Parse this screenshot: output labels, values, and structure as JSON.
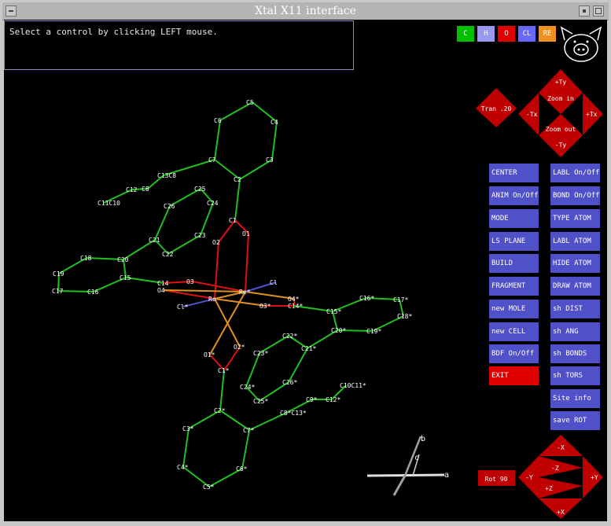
{
  "window": {
    "title": "Xtal X11 interface"
  },
  "message": "Select a control by clicking LEFT mouse.",
  "color_buttons": [
    {
      "label": "C",
      "color": "#00c000"
    },
    {
      "label": "H",
      "color": "#9898f0"
    },
    {
      "label": "O",
      "color": "#e00000"
    },
    {
      "label": "CL",
      "color": "#6868f8"
    },
    {
      "label": "RE",
      "color": "#f09020"
    }
  ],
  "nav": {
    "tran": "Tran .20",
    "up": "+Ty",
    "down": "-Ty",
    "left": "-Tx",
    "right": "+Tx",
    "zoom_in": "Zoom in",
    "zoom_out": "Zoom out"
  },
  "rot": {
    "label": "Rot 90",
    "top": "-X",
    "bottom": "+X",
    "left": "-Y",
    "right": "+Y",
    "z_minus": "-Z",
    "z_plus": "+Z"
  },
  "left_buttons": [
    "CENTER",
    "ANIM On/Off",
    "MODE",
    "LS PLANE",
    "BUILD",
    "FRAGMENT",
    "new MOLE",
    "new CELL",
    "BDF On/Off",
    "EXIT"
  ],
  "right_buttons": [
    "LABL On/Off",
    "BOND On/Off",
    "TYPE ATOM",
    "LABL ATOM",
    "HIDE ATOM",
    "DRAW ATOM",
    "sh DIST",
    "sh ANG",
    "sh BONDS",
    "sh TORS",
    "Site info",
    "save ROT"
  ],
  "axes": {
    "a": "a",
    "b": "b",
    "c": "c"
  },
  "bond_colors": {
    "carbon": "#20c020",
    "oxygen": "#e01010",
    "metal": "#e09020",
    "chlorine": "#5050d0"
  },
  "atoms": [
    {
      "label": "C5"
    },
    {
      "label": "C6"
    },
    {
      "label": "C4"
    },
    {
      "label": "C7"
    },
    {
      "label": "C3"
    },
    {
      "label": "C2"
    },
    {
      "label": "C13C8"
    },
    {
      "label": "C12"
    },
    {
      "label": "C8"
    },
    {
      "label": "C11C10"
    },
    {
      "label": "C25"
    },
    {
      "label": "C24"
    },
    {
      "label": "C26"
    },
    {
      "label": "C1"
    },
    {
      "label": "C21"
    },
    {
      "label": "C23"
    },
    {
      "label": "O2"
    },
    {
      "label": "O1"
    },
    {
      "label": "C22"
    },
    {
      "label": "C18"
    },
    {
      "label": "C20"
    },
    {
      "label": "C19"
    },
    {
      "label": "C15"
    },
    {
      "label": "C14"
    },
    {
      "label": "O3"
    },
    {
      "label": "C17"
    },
    {
      "label": "O4"
    },
    {
      "label": "C16"
    },
    {
      "label": "Cl"
    },
    {
      "label": "Re"
    },
    {
      "label": "Re*"
    },
    {
      "label": "O4*"
    },
    {
      "label": "Cl*"
    },
    {
      "label": "O3*"
    },
    {
      "label": "C14*"
    },
    {
      "label": "C16*"
    },
    {
      "label": "C17*"
    },
    {
      "label": "C15*"
    },
    {
      "label": "C18*"
    },
    {
      "label": "C20*"
    },
    {
      "label": "C19*"
    },
    {
      "label": "C22*"
    },
    {
      "label": "O2*"
    },
    {
      "label": "C21*"
    },
    {
      "label": "O1*"
    },
    {
      "label": "C1*"
    },
    {
      "label": "C23*"
    },
    {
      "label": "C26*"
    },
    {
      "label": "C24*"
    },
    {
      "label": "C25*"
    },
    {
      "label": "C10C11*"
    },
    {
      "label": "C9*"
    },
    {
      "label": "C12*"
    },
    {
      "label": "C8*C13*"
    },
    {
      "label": "C2*"
    },
    {
      "label": "C7*"
    },
    {
      "label": "C3*"
    },
    {
      "label": "C4*"
    },
    {
      "label": "C6*"
    },
    {
      "label": "C5*"
    }
  ]
}
